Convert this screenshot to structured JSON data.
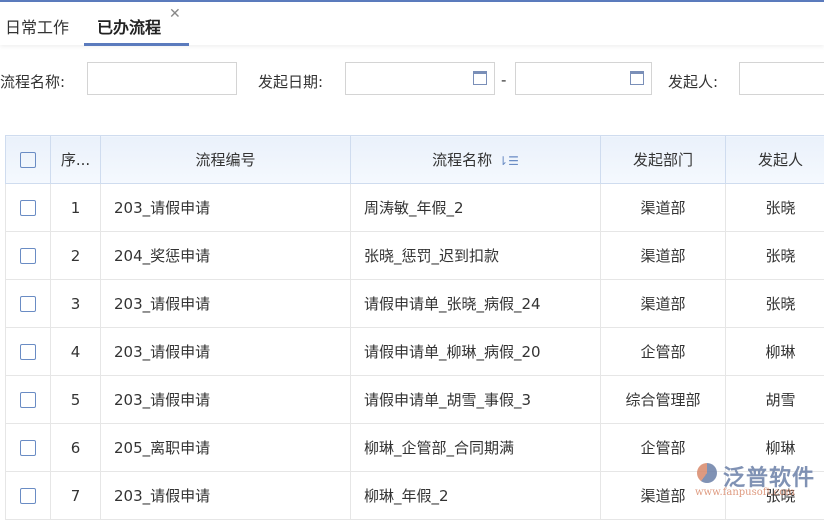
{
  "tabs": [
    {
      "label": "日常工作"
    },
    {
      "label": "已办流程"
    }
  ],
  "filters": {
    "process_name_label": "流程名称:",
    "start_date_label": "发起日期:",
    "date_separator": "-",
    "initiator_label": "发起人:"
  },
  "table": {
    "headers": [
      "序...",
      "流程编号",
      "流程名称",
      "发起部门",
      "发起人"
    ],
    "rows": [
      [
        "1",
        "203_请假申请",
        "周涛敏_年假_2",
        "渠道部",
        "张晓"
      ],
      [
        "2",
        "204_奖惩申请",
        "张晓_惩罚_迟到扣款",
        "渠道部",
        "张晓"
      ],
      [
        "3",
        "203_请假申请",
        "请假申请单_张晓_病假_24",
        "渠道部",
        "张晓"
      ],
      [
        "4",
        "203_请假申请",
        "请假申请单_柳琳_病假_20",
        "企管部",
        "柳琳"
      ],
      [
        "5",
        "203_请假申请",
        "请假申请单_胡雪_事假_3",
        "综合管理部",
        "胡雪"
      ],
      [
        "6",
        "205_离职申请",
        "柳琳_企管部_合同期满",
        "企管部",
        "柳琳"
      ],
      [
        "7",
        "203_请假申请",
        "柳琳_年假_2",
        "渠道部",
        "张晓"
      ]
    ]
  },
  "watermark": {
    "name": "泛普软件",
    "url": "www.fanpusoft.com"
  }
}
